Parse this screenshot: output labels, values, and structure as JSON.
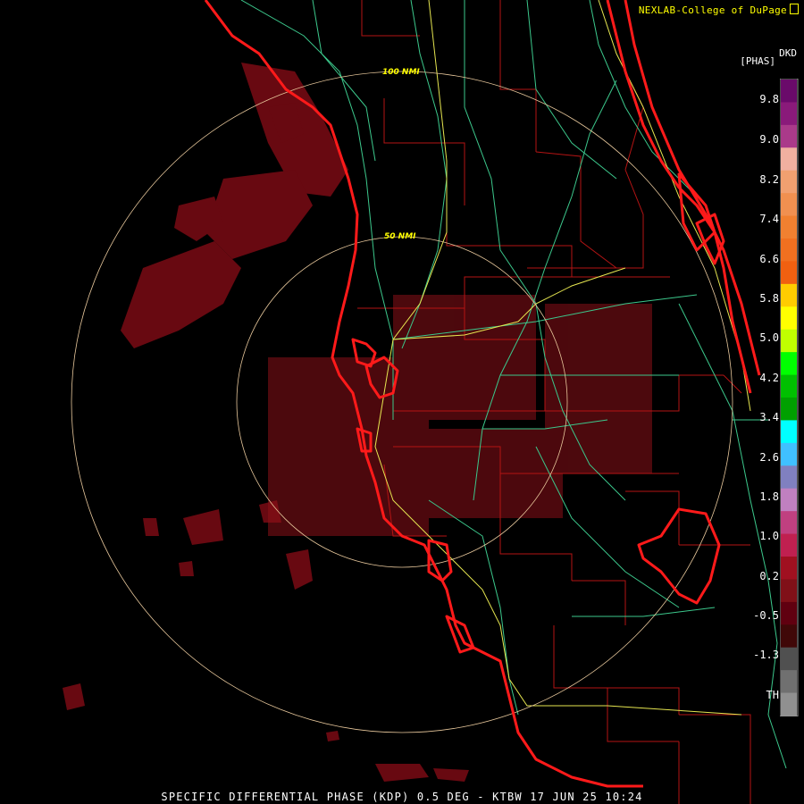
{
  "credit": "NEXLAB-College of DuPage",
  "footer": "SPECIFIC DIFFERENTIAL PHASE (KDP) 0.5 DEG - KTBW 17 JUN 25 10:24",
  "legend": {
    "title": "[PHAS]",
    "code": "DKD",
    "labels": [
      "9.8",
      "9.0",
      "8.2",
      "7.4",
      "6.6",
      "5.8",
      "5.0",
      "4.2",
      "3.4",
      "2.6",
      "1.8",
      "1.0",
      "0.2",
      "-0.5",
      "-1.3",
      "TH"
    ]
  },
  "range_rings": [
    "100 NMI",
    "50 NMI"
  ],
  "colors": {
    "coast": "#ff1a1a",
    "county": "#b41414",
    "roads": "#3cc88c",
    "highway": "#e6e650",
    "rings": "#e8c89c",
    "ring_label": "#ffff00",
    "echo": "#7a0a14"
  }
}
